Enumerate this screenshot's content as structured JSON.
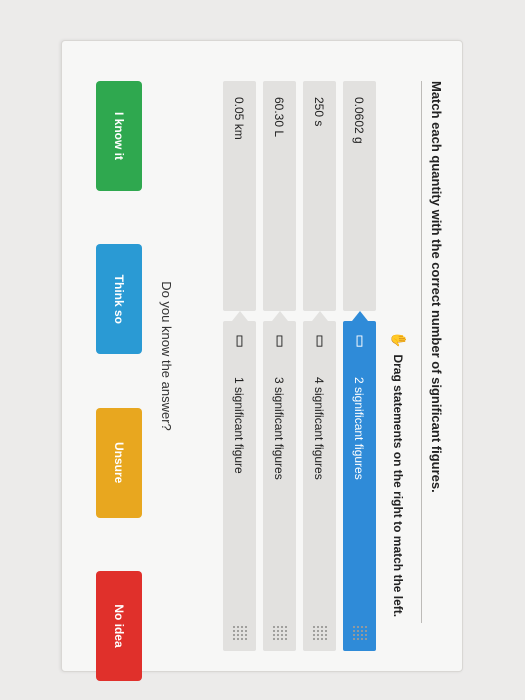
{
  "question": {
    "title": "Match each quantity with the correct number of significant figures.",
    "instruction": "Drag statements on the right to match the left."
  },
  "matching": {
    "left_items": [
      "0.0602 g",
      "250 s",
      "60.30 L",
      "0.05 km"
    ],
    "right_items": [
      "2 significant figures",
      "4 significant figures",
      "3 significant figures",
      "1 significant figure"
    ],
    "active_right_index": 0
  },
  "confidence": {
    "prompt": "Do you know the answer?",
    "buttons": [
      "I know it",
      "Think so",
      "Unsure",
      "No idea"
    ]
  },
  "icons": {
    "drag": "drag-hand-icon",
    "handle": "drag-handle-icon",
    "grip": "grip-dots-icon"
  },
  "colors": {
    "active": "#2f8bd8",
    "green": "#2fa84f",
    "blue": "#2a9ad4",
    "orange": "#e8a71f",
    "red": "#e0302b"
  }
}
